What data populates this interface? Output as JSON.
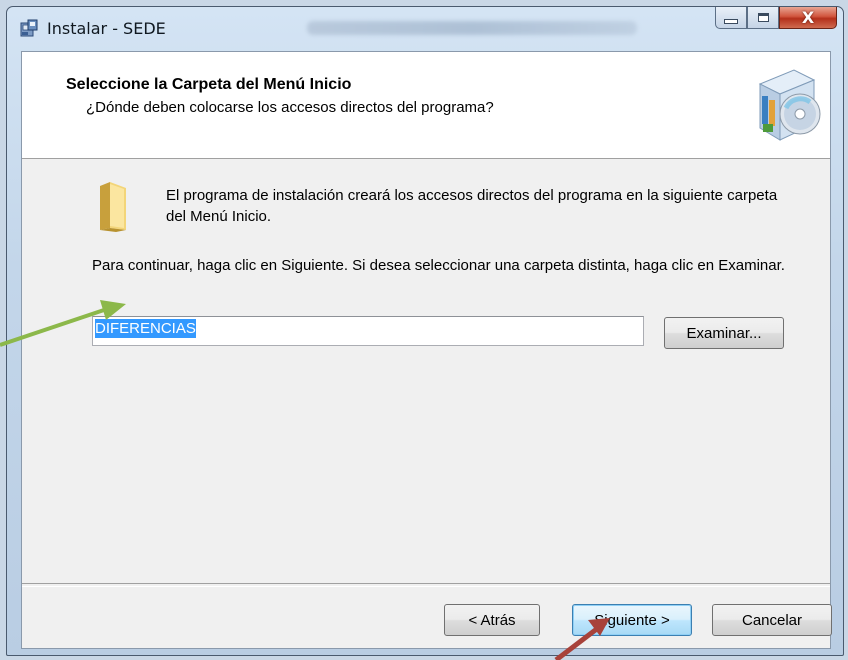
{
  "window": {
    "title": "Instalar - SEDE",
    "controls": {
      "minimize_icon": "minimize-icon",
      "maximize_icon": "maximize-icon",
      "close_label": "X"
    }
  },
  "header": {
    "title": "Seleccione la Carpeta del Menú Inicio",
    "subtitle": "¿Dónde deben colocarse los accesos directos del programa?"
  },
  "body": {
    "info": "El programa de instalación creará los accesos directos del programa en la siguiente carpeta del Menú Inicio.",
    "instructions": "Para continuar, haga clic en Siguiente. Si desea seleccionar una carpeta distinta, haga clic en Examinar.",
    "folder_value": "DIFERENCIAS",
    "browse_label": "Examinar..."
  },
  "footer": {
    "back_label": "< Atrás",
    "next_label": "Siguiente >",
    "cancel_label": "Cancelar"
  },
  "colors": {
    "selection": "#3399ff",
    "arrow_green": "#8cb84a",
    "arrow_red": "#a8423a"
  }
}
